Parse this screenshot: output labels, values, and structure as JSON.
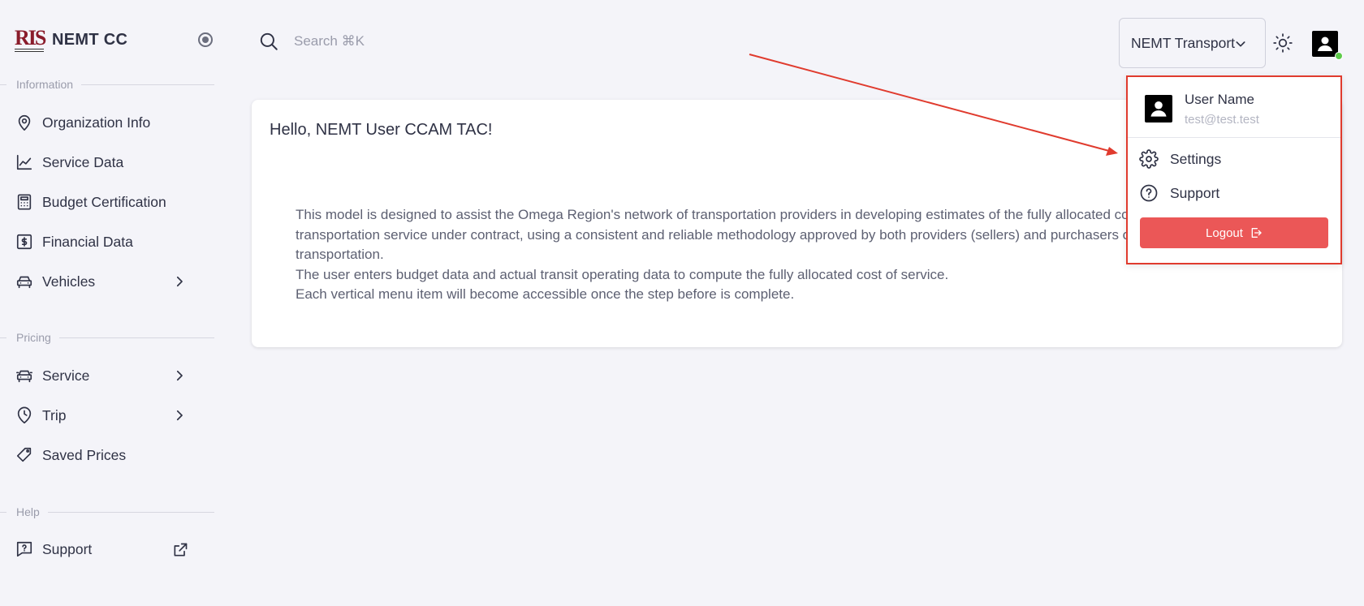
{
  "brand": {
    "logo_text": "RIS",
    "name": "NEMT CC"
  },
  "sidebar": {
    "sections": [
      {
        "label": "Information"
      },
      {
        "label": "Pricing"
      },
      {
        "label": "Help"
      }
    ],
    "items": [
      {
        "label": "Organization Info",
        "icon": "map-pin-icon"
      },
      {
        "label": "Service Data",
        "icon": "line-chart-icon"
      },
      {
        "label": "Budget Certification",
        "icon": "calculator-icon"
      },
      {
        "label": "Financial Data",
        "icon": "dollar-bill-icon"
      },
      {
        "label": "Vehicles",
        "icon": "car-icon",
        "has_submenu": true
      },
      {
        "label": "Service",
        "icon": "vehicle-icon",
        "has_submenu": true
      },
      {
        "label": "Trip",
        "icon": "clock-pin-icon",
        "has_submenu": true
      },
      {
        "label": "Saved Prices",
        "icon": "tag-icon"
      },
      {
        "label": "Support",
        "icon": "help-message-icon",
        "external": true
      }
    ]
  },
  "search": {
    "placeholder": "Search ⌘K"
  },
  "org_select": {
    "value": "NEMT Transport"
  },
  "main": {
    "greeting": "Hello, NEMT User CCAM TAC!",
    "paragraph_lines": [
      "This model is designed to assist the Omega Region's network of transportation providers in developing estimates of the fully allocated cost of",
      "transportation service under contract, using a consistent and reliable methodology approved by both providers (sellers) and purchasers of",
      "transportation.",
      "The user enters budget data and actual transit operating data to compute the fully allocated cost of service.",
      "Each vertical menu item will become accessible once the step before is complete."
    ]
  },
  "user_menu": {
    "name": "User Name",
    "email": "test@test.test",
    "items": [
      {
        "label": "Settings",
        "icon": "gear-icon"
      },
      {
        "label": "Support",
        "icon": "help-circle-icon"
      }
    ],
    "logout_label": "Logout"
  },
  "colors": {
    "accent_red": "#eb5757",
    "annotation_red": "#e03b2e",
    "online_green": "#5ecb4b",
    "background": "#f4f4f9"
  }
}
